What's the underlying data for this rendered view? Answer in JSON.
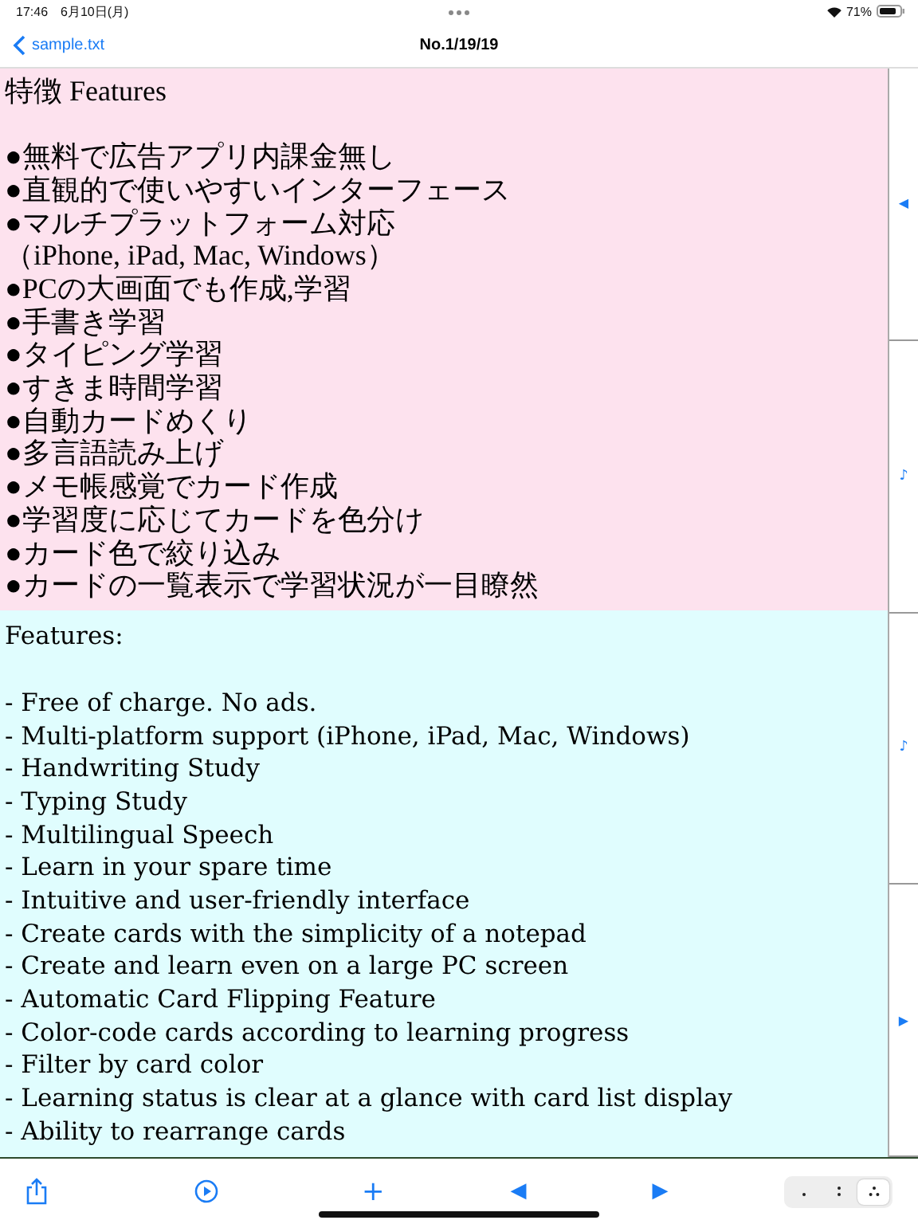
{
  "status_bar": {
    "time": "17:46",
    "date": "6月10日(月)",
    "battery_text": "71%"
  },
  "nav_bar": {
    "back_label": "sample.txt",
    "title": "No.1/19/19"
  },
  "cards": [
    {
      "kind": "front",
      "heading": "特徴 Features",
      "lines": [
        "●無料で広告アプリ内課金無し",
        "●直観的で使いやすいインターフェース",
        "●マルチプラットフォーム対応",
        "（iPhone, iPad, Mac, Windows）",
        "●PCの大画面でも作成,学習",
        "●手書き学習",
        "●タイピング学習",
        "●すきま時間学習",
        "●自動カードめくり",
        "●多言語読み上げ",
        "●メモ帳感覚でカード作成",
        "●学習度に応じてカードを色分け",
        "●カード色で絞り込み",
        "●カードの一覧表示で学習状況が一目瞭然"
      ]
    },
    {
      "kind": "back",
      "heading": "Features:",
      "lines": [
        "- Free of charge. No ads.",
        "- Multi-platform support (iPhone, iPad, Mac, Windows)",
        "- Handwriting Study",
        "- Typing Study",
        "- Multilingual Speech",
        "- Learn in your spare time",
        "- Intuitive and user-friendly interface",
        "- Create cards with the simplicity of a notepad",
        "- Create and learn even on a large PC screen",
        "- Automatic Card Flipping Feature",
        "- Color-code cards according to learning progress",
        "- Filter by card color",
        "- Learning status is clear at a glance with card list display",
        "- Ability to rearrange cards"
      ]
    }
  ],
  "side_buttons": [
    "◀",
    "♪",
    "♪",
    "▶"
  ],
  "toolbar": {
    "prev": "◀",
    "next": "▶",
    "plus": "+"
  },
  "density_segments": [
    {
      "kind": "one-dot",
      "selected": false
    },
    {
      "kind": "two-dots",
      "selected": false
    },
    {
      "kind": "three-dots",
      "selected": true
    }
  ]
}
